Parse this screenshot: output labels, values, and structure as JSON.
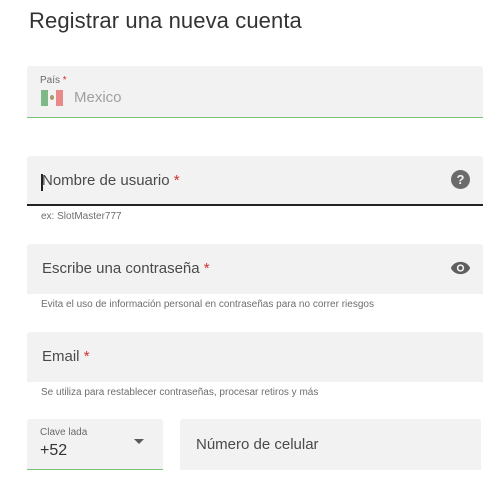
{
  "page": {
    "title": "Registrar una nueva cuenta"
  },
  "form": {
    "country": {
      "label": "País",
      "required_mark": "*",
      "value": "Mexico",
      "icon": "mexico-flag-icon"
    },
    "username": {
      "placeholder": "Nombre de usuario",
      "required_mark": "*",
      "hint": "ex: SlotMaster777",
      "icon": "help-icon"
    },
    "password": {
      "placeholder": "Escribe una contraseña",
      "required_mark": "*",
      "hint": "Evita el uso de información personal en contraseñas para no correr riesgos",
      "icon": "eye-icon"
    },
    "email": {
      "placeholder": "Email",
      "required_mark": "*",
      "hint": "Se utiliza para restablecer contraseñas, procesar retiros y más"
    },
    "area_code": {
      "label": "Clave lada",
      "value": "+52",
      "icon": "chevron-down-icon"
    },
    "phone": {
      "placeholder": "Número de celular"
    }
  },
  "colors": {
    "accent_green": "#7cc576",
    "required_red": "#d0312d",
    "field_bg": "#f2f2f2"
  }
}
